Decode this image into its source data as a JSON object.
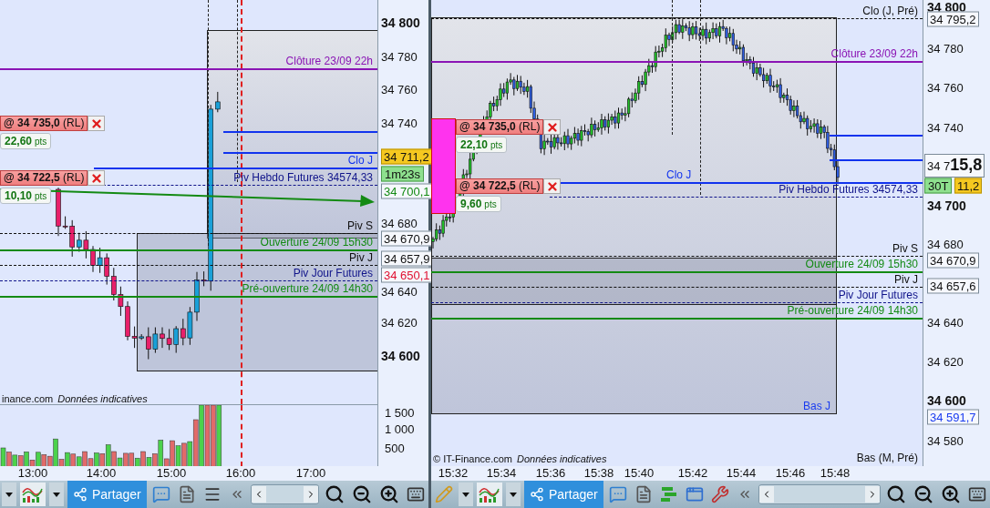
{
  "panels": [
    {
      "levels": [
        {
          "label": "Clôture 23/09 22h",
          "color": "#8a14b4",
          "kind": "solid"
        },
        {
          "label": "Clo J",
          "color": "#1133ee",
          "kind": "solid"
        },
        {
          "label": "Piv Hebdo Futures 34574,33",
          "color": "#10148a",
          "kind": "dashed"
        },
        {
          "label": "Piv S",
          "color": "#111111",
          "kind": "dashed"
        },
        {
          "label": "Ouverture 24/09 15h30",
          "color": "#138a13",
          "kind": "solid"
        },
        {
          "label": "Piv J",
          "color": "#111111",
          "kind": "dashed"
        },
        {
          "label": "Piv Jour Futures",
          "color": "#10148a",
          "kind": "dashed"
        },
        {
          "label": "Pré-ouverture 24/09 14h30",
          "color": "#138a13",
          "kind": "solid"
        }
      ],
      "orders": [
        {
          "label": "**@ 34 735,0** (RL)",
          "gain": "22,60",
          "unit": "pts"
        },
        {
          "label": "**@ 34 722,5** (RL)",
          "gain": "10,10",
          "unit": "pts"
        }
      ],
      "notice": {
        "source": "inance.com",
        "note": "Données indicatives"
      },
      "price_axis": [
        {
          "text": "34 800",
          "kind": "major"
        },
        {
          "text": "34 780",
          "kind": "tick"
        },
        {
          "text": "34 760",
          "kind": "tick"
        },
        {
          "text": "34 740",
          "kind": "tick"
        },
        {
          "text": "34 711,2",
          "kind": "last"
        },
        {
          "text": "1m23s",
          "kind": "timer"
        },
        {
          "text": "34 700,1",
          "kind": "boxed",
          "color": "#138a13"
        },
        {
          "text": "34 680",
          "kind": "tick"
        },
        {
          "text": "34 670,9",
          "kind": "boxed",
          "color": "#111111"
        },
        {
          "text": "34 657,9",
          "kind": "boxed",
          "color": "#111111"
        },
        {
          "text": "34 650,1",
          "kind": "boxed",
          "color": "#e01030"
        },
        {
          "text": "34 640",
          "kind": "tick"
        },
        {
          "text": "34 620",
          "kind": "tick"
        },
        {
          "text": "34 600",
          "kind": "major"
        }
      ],
      "volume_axis": [
        "1 500",
        "1 000",
        "500"
      ],
      "time_axis": [
        "13:00",
        "14:00",
        "15:00",
        "16:00",
        "17:00"
      ],
      "toolbar": [
        {
          "kind": "caret"
        },
        {
          "kind": "indicators"
        },
        {
          "kind": "caret"
        },
        {
          "kind": "share",
          "label": "Partager"
        },
        {
          "kind": "comment"
        },
        {
          "kind": "report"
        },
        {
          "kind": "menu"
        },
        {
          "kind": "collapse"
        },
        {
          "kind": "scrollbar"
        },
        {
          "kind": "zoom-fit"
        },
        {
          "kind": "zoom-out"
        },
        {
          "kind": "zoom-in"
        },
        {
          "kind": "keyboard"
        }
      ]
    },
    {
      "levels": [
        {
          "label": "Clo (J, Pré)",
          "color": "#111111",
          "kind": "dashed"
        },
        {
          "label": "Clôture 23/09 22h",
          "color": "#8a14b4",
          "kind": "solid"
        },
        {
          "label": "Clo J",
          "color": "#1133ee",
          "kind": "solid"
        },
        {
          "label": "Piv Hebdo Futures 34574,33",
          "color": "#10148a",
          "kind": "dashed"
        },
        {
          "label": "Piv S",
          "color": "#111111",
          "kind": "dashed"
        },
        {
          "label": "Ouverture 24/09 15h30",
          "color": "#138a13",
          "kind": "solid"
        },
        {
          "label": "Piv J",
          "color": "#111111",
          "kind": "dashed"
        },
        {
          "label": "Piv Jour Futures",
          "color": "#10148a",
          "kind": "dashed"
        },
        {
          "label": "Pré-ouverture 24/09 14h30",
          "color": "#138a13",
          "kind": "solid"
        },
        {
          "label": "Bas (M, Pré)",
          "color": "#111111",
          "kind": "label"
        }
      ],
      "range_label": "Bas J",
      "orders": [
        {
          "label": "**@ 34 735,0** (RL)",
          "gain": "22,10",
          "unit": "pts"
        },
        {
          "label": "**@ 34 722,5** (RL)",
          "gain": "9,60",
          "unit": "pts"
        }
      ],
      "notice": {
        "source": "© IT-Finance.com",
        "note": "Données indicatives"
      },
      "price_axis": [
        {
          "text": "34 800",
          "kind": "major"
        },
        {
          "text": "34 795,2",
          "kind": "boxed",
          "color": "#111111"
        },
        {
          "text": "34 780",
          "kind": "tick"
        },
        {
          "text": "34 760",
          "kind": "tick"
        },
        {
          "text": "34 740",
          "kind": "tick"
        },
        {
          "text": "34 7",
          "big": "15,8",
          "kind": "current"
        },
        {
          "text": "30T",
          "kind": "timer"
        },
        {
          "text": "11,2",
          "kind": "last"
        },
        {
          "text": "34 700",
          "kind": "major"
        },
        {
          "text": "34 680",
          "kind": "tick"
        },
        {
          "text": "34 670,9",
          "kind": "boxed",
          "color": "#111111"
        },
        {
          "text": "34 657,6",
          "kind": "boxed",
          "color": "#111111"
        },
        {
          "text": "34 640",
          "kind": "tick"
        },
        {
          "text": "34 620",
          "kind": "tick"
        },
        {
          "text": "34 600",
          "kind": "major"
        },
        {
          "text": "34 591,7",
          "kind": "boxed",
          "color": "#1a3cf0"
        },
        {
          "text": "34 580",
          "kind": "tick"
        }
      ],
      "time_axis": [
        "15:32",
        "15:34",
        "15:36",
        "15:38",
        "15:40",
        "15:42",
        "15:44",
        "15:46",
        "15:48"
      ],
      "toolbar": [
        {
          "kind": "drawing"
        },
        {
          "kind": "caret"
        },
        {
          "kind": "indicators"
        },
        {
          "kind": "caret"
        },
        {
          "kind": "share",
          "label": "Partager"
        },
        {
          "kind": "comment"
        },
        {
          "kind": "report"
        },
        {
          "kind": "bars"
        },
        {
          "kind": "windows"
        },
        {
          "kind": "tools"
        },
        {
          "kind": "collapse"
        },
        {
          "kind": "scrollbar"
        },
        {
          "kind": "zoom-fit"
        },
        {
          "kind": "zoom-out"
        },
        {
          "kind": "zoom-in"
        },
        {
          "kind": "keyboard"
        }
      ]
    }
  ]
}
